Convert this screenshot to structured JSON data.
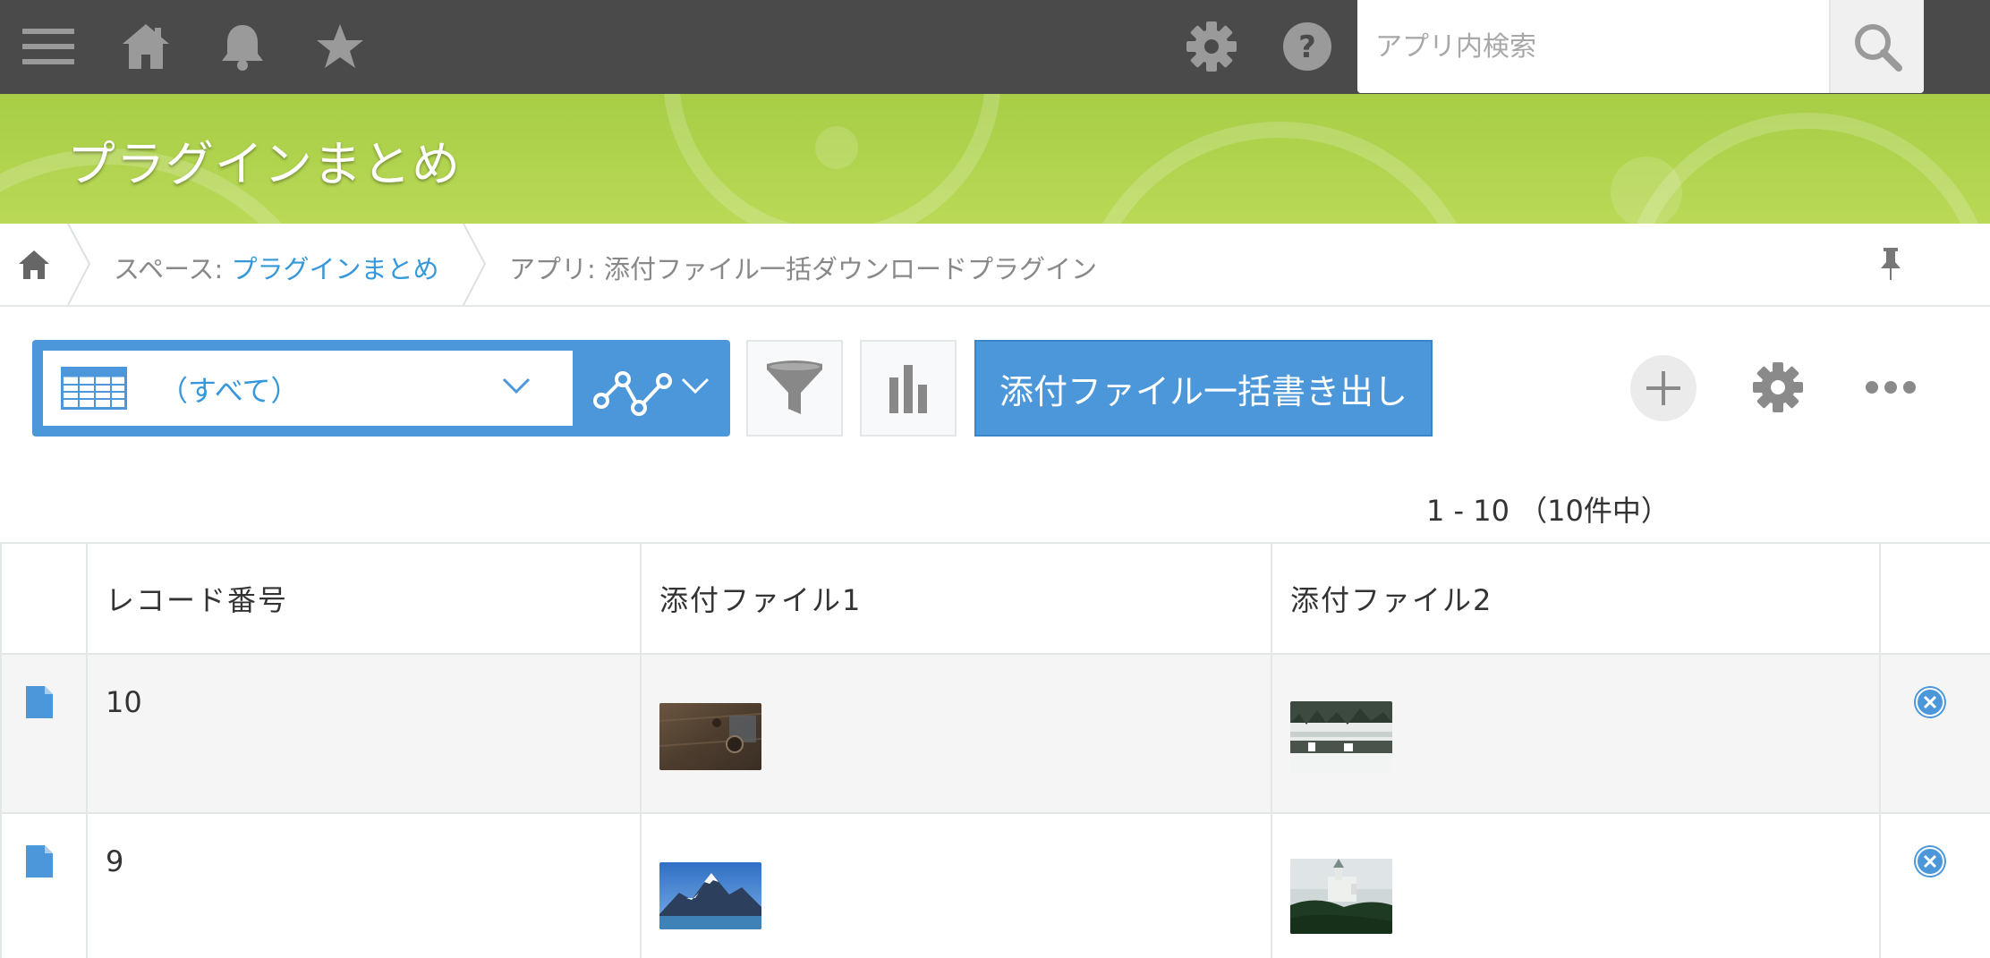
{
  "header": {
    "icons": {
      "menu": "menu-icon",
      "home": "home-icon",
      "notifications": "bell-icon",
      "favorites": "star-icon",
      "settings": "gear-icon",
      "help": "help-icon",
      "search": "search-icon"
    },
    "search": {
      "placeholder": "アプリ内検索",
      "value": ""
    }
  },
  "space": {
    "title": "プラグインまとめ",
    "color": "#a7cd45"
  },
  "breadcrumb": {
    "space_prefix": "スペース: ",
    "space_name": "プラグインまとめ",
    "app_label": "アプリ: 添付ファイル一括ダウンロードプラグイン"
  },
  "toolbar": {
    "view_selected": "（すべて）",
    "export_button": "添付ファイル一括書き出し",
    "accent_color": "#4b97d9"
  },
  "pagination": {
    "text": "1 - 10 （10件中）"
  },
  "table": {
    "columns": [
      "",
      "レコード番号",
      "添付ファイル1",
      "添付ファイル2",
      ""
    ],
    "rows": [
      {
        "record_number": "10"
      },
      {
        "record_number": "9"
      }
    ]
  }
}
